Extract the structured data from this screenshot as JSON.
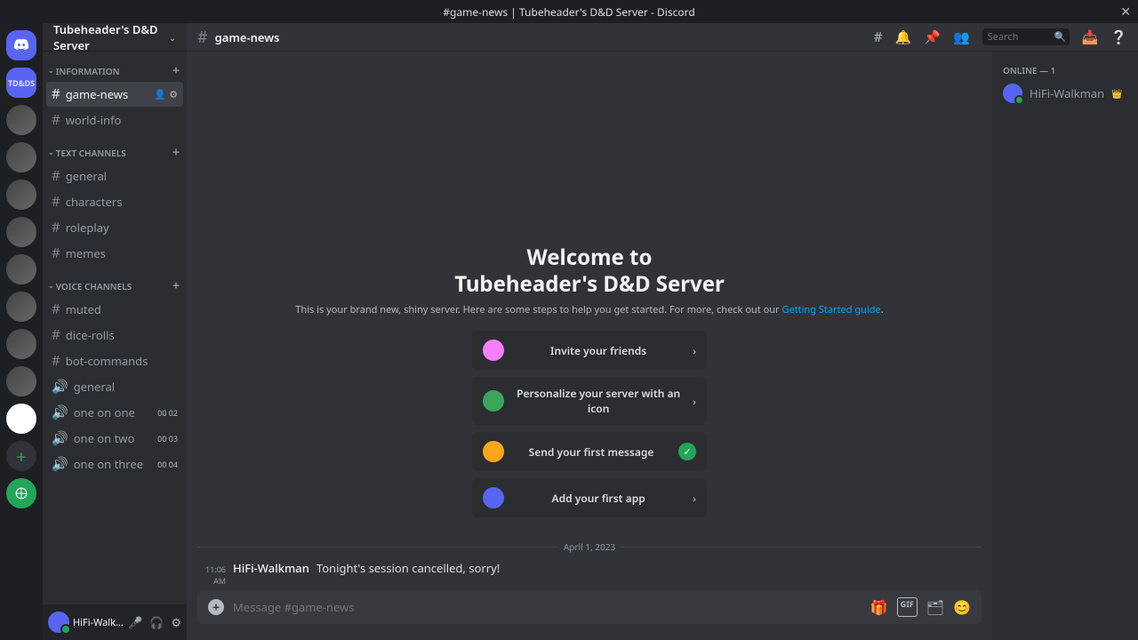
{
  "titlebar": {
    "text": "#game-news | Tubeheader's D&D Server - Discord"
  },
  "server_header": {
    "name": "Tubeheader's D&D Server"
  },
  "active_server_abbr": "TD&DS",
  "categories": [
    {
      "name": "INFORMATION",
      "channels": [
        {
          "name": "game-news",
          "type": "text",
          "selected": true
        },
        {
          "name": "world-info",
          "type": "text"
        }
      ]
    },
    {
      "name": "TEXT CHANNELS",
      "channels": [
        {
          "name": "general",
          "type": "text",
          "hover": true
        },
        {
          "name": "characters",
          "type": "text"
        },
        {
          "name": "roleplay",
          "type": "text"
        },
        {
          "name": "memes",
          "type": "text"
        }
      ]
    },
    {
      "name": "VOICE CHANNELS",
      "channels": [
        {
          "name": "muted",
          "type": "text"
        },
        {
          "name": "dice-rolls",
          "type": "text"
        },
        {
          "name": "bot-commands",
          "type": "text"
        },
        {
          "name": "general",
          "type": "voice"
        },
        {
          "name": "one on one",
          "type": "voice",
          "badge": "00  02"
        },
        {
          "name": "one on two",
          "type": "voice",
          "badge": "00  03"
        },
        {
          "name": "one on three",
          "type": "voice",
          "badge": "00  04"
        }
      ]
    }
  ],
  "user_panel": {
    "name": "HiFi-Walk..."
  },
  "channel_header": {
    "name": "game-news",
    "search_placeholder": "Search"
  },
  "welcome": {
    "line1": "Welcome to",
    "line2": "Tubeheader's D&D Server",
    "desc": "This is your brand new, shiny server. Here are some steps to help you get started. For more, check out our ",
    "link": "Getting Started guide"
  },
  "onboard": [
    {
      "text": "Invite your friends",
      "color": "#f47fff",
      "done": false
    },
    {
      "text": "Personalize your server with an icon",
      "color": "#3ba55c",
      "done": false
    },
    {
      "text": "Send your first message",
      "color": "#faa61a",
      "done": true
    },
    {
      "text": "Add your first app",
      "color": "#5865f2",
      "done": false
    }
  ],
  "divider_date": "April 1, 2023",
  "message": {
    "time": "11:06 AM",
    "author": "HiFi-Walkman",
    "text": "Tonight's session cancelled, sorry!"
  },
  "input_placeholder": "Message #game-news",
  "members": {
    "header": "ONLINE — 1",
    "list": [
      {
        "name": "HiFi-Walkman",
        "crown": true
      }
    ]
  }
}
